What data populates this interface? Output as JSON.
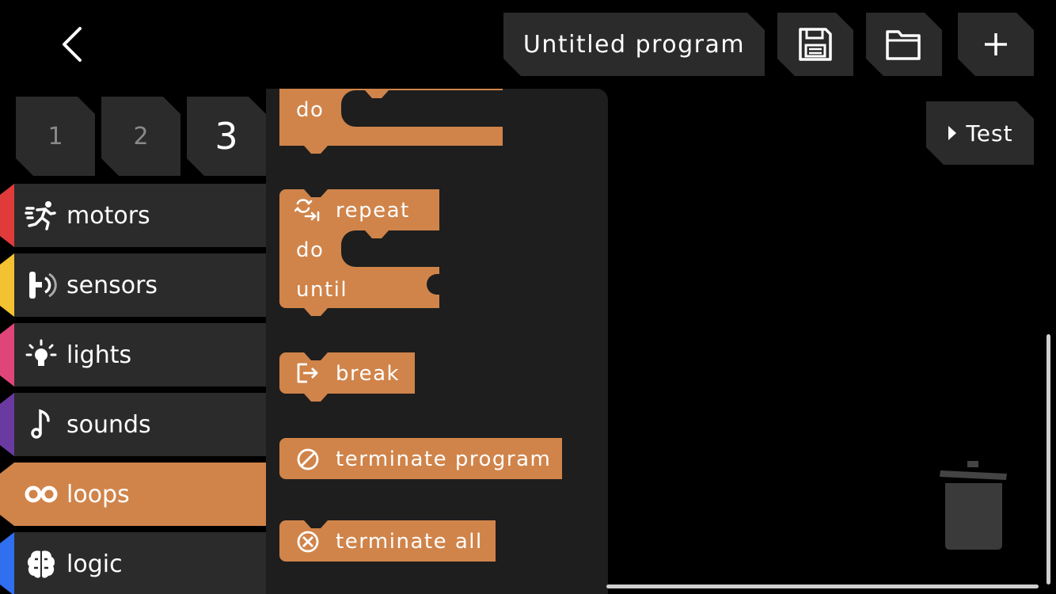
{
  "header": {
    "program_title": "Untitled program",
    "test_label": "Test"
  },
  "page_tabs": [
    {
      "label": "1"
    },
    {
      "label": "2"
    },
    {
      "label": "3"
    }
  ],
  "categories": [
    {
      "label": "motors",
      "color": "#e03a3a"
    },
    {
      "label": "sensors",
      "color": "#f2c230"
    },
    {
      "label": "lights",
      "color": "#e0457a"
    },
    {
      "label": "sounds",
      "color": "#6a3aa0"
    },
    {
      "label": "loops",
      "color": "#d0844a"
    },
    {
      "label": "logic",
      "color": "#2f6ff0"
    }
  ],
  "blocks": {
    "do_top": "do",
    "repeat": "repeat",
    "repeat_do": "do",
    "until": "until",
    "break": "break",
    "terminate_program": "terminate program",
    "terminate_all": "terminate all"
  },
  "colors": {
    "block": "#d0844a",
    "tile": "#2b2b2b",
    "flyout": "#1e1e1e"
  }
}
